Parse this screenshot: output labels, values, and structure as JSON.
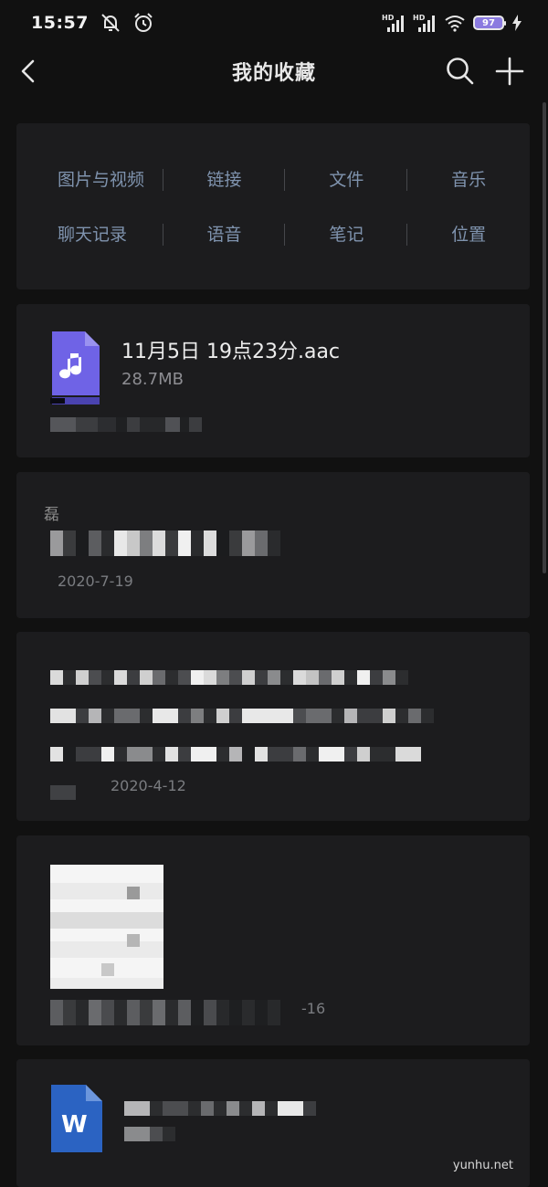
{
  "status_bar": {
    "time": "15:57",
    "signal_label_1": "HD",
    "signal_label_2": "HD",
    "battery": "97",
    "icons": [
      "mute-icon",
      "alarm-icon",
      "signal-icon",
      "signal-icon",
      "wifi-icon",
      "battery-icon",
      "charging-icon"
    ]
  },
  "nav": {
    "title": "我的收藏",
    "icons": [
      "back-icon",
      "search-icon",
      "add-icon"
    ]
  },
  "filters": {
    "row1": [
      "图片与视频",
      "链接",
      "文件",
      "音乐"
    ],
    "row2": [
      "聊天记录",
      "语音",
      "笔记",
      "位置"
    ]
  },
  "items": [
    {
      "type": "file",
      "name": "11月5日 19点23分.aac",
      "size": "28.7MB"
    },
    {
      "type": "chat",
      "snippet": "磊",
      "date": "2020-7-19"
    },
    {
      "type": "note",
      "date": "2020-4-12"
    },
    {
      "type": "image",
      "date_fragment": "-16"
    },
    {
      "type": "document",
      "icon": "word-icon",
      "icon_letter": "W"
    }
  ],
  "watermark": "yunhu.net",
  "colors": {
    "background": "#111111",
    "card": "#1c1c1e",
    "filter_text": "#7f93ae",
    "music_icon": "#6f63e6",
    "word_icon": "#2b63c2",
    "battery_fill": "#8b7be0"
  }
}
